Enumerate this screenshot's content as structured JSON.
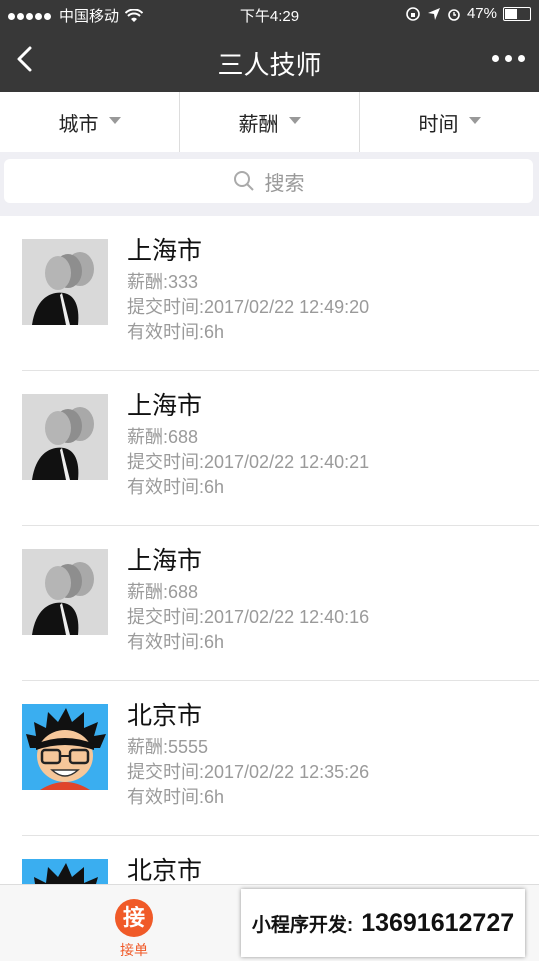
{
  "status": {
    "carrier": "中国移动",
    "time": "下午4:29",
    "battery": "47%"
  },
  "nav": {
    "title": "三人技师"
  },
  "filters": [
    {
      "label": "城市"
    },
    {
      "label": "薪酬"
    },
    {
      "label": "时间"
    }
  ],
  "search": {
    "placeholder": "搜索"
  },
  "items": [
    {
      "city": "上海市",
      "salary": "薪酬:333",
      "submitted": "提交时间:2017/02/22 12:49:20",
      "valid": "有效时间:6h",
      "avatar": "bw-portrait-icon"
    },
    {
      "city": "上海市",
      "salary": "薪酬:688",
      "submitted": "提交时间:2017/02/22 12:40:21",
      "valid": "有效时间:6h",
      "avatar": "bw-portrait-icon"
    },
    {
      "city": "上海市",
      "salary": "薪酬:688",
      "submitted": "提交时间:2017/02/22 12:40:16",
      "valid": "有效时间:6h",
      "avatar": "bw-portrait-icon"
    },
    {
      "city": "北京市",
      "salary": "薪酬:5555",
      "submitted": "提交时间:2017/02/22 12:35:26",
      "valid": "有效时间:6h",
      "avatar": "cartoon-boy-icon"
    },
    {
      "city": "北京市",
      "avatar": "cartoon-boy-icon"
    }
  ],
  "tabbar": {
    "tab_icon_char": "接",
    "tab_label": "接单"
  },
  "promo": {
    "label": "小程序开发:",
    "phone": "13691612727"
  },
  "colors": {
    "nav": "#383838",
    "accent": "#f05a28"
  }
}
